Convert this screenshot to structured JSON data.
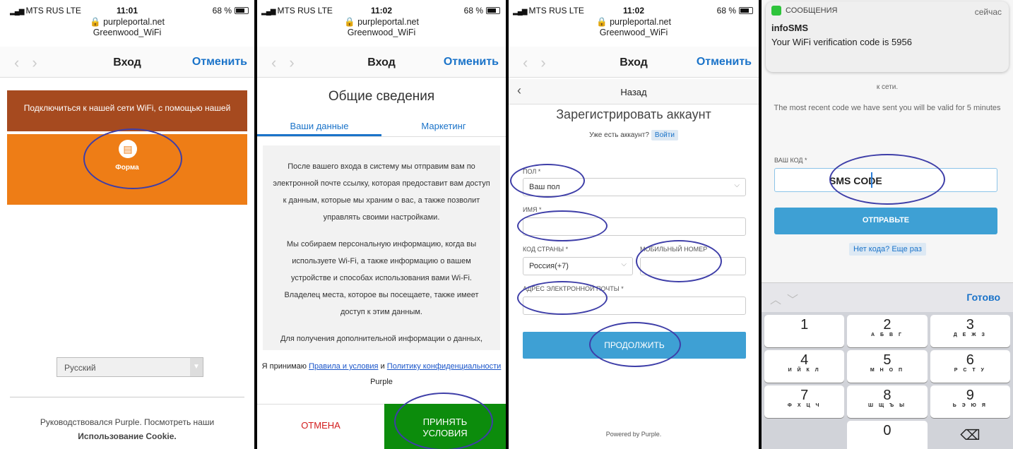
{
  "status": [
    {
      "carrier": "MTS RUS  LTE",
      "time": "11:01",
      "battery": "68 %"
    },
    {
      "carrier": "MTS RUS  LTE",
      "time": "11:02",
      "battery": "68 %"
    },
    {
      "carrier": "MTS RUS  LTE",
      "time": "11:02",
      "battery": "68 %"
    }
  ],
  "browser": {
    "url": "purpleportal.net",
    "network": "Greenwood_WiFi",
    "title": "Вход",
    "cancel": "Отменить"
  },
  "screen1": {
    "banner": "Подключиться к нашей сети WiFi, с помощью нашей",
    "form_label": "Форма",
    "language": "Русский",
    "footer_line1": "Руководствовался Purple. Посмотреть наши",
    "footer_line2": "Использование Cookie."
  },
  "screen2": {
    "heading": "Общие сведения",
    "tab_data": "Ваши данные",
    "tab_marketing": "Маркетинг",
    "para1": "После вашего входа в систему мы отправим вам по электронной почте ссылку, которая предоставит вам доступ к данным, которые мы храним о вас, а также позволит управлять своими настройками.",
    "para2": "Мы собираем персональную информацию, когда вы используете Wi-Fi, а также информацию о вашем устройстве и способах использования вами Wi-Fi. Владелец места, которое вы посещаете, также имеет доступ к этим данным.",
    "para3": "Для получения дополнительной информации о данных, которые мы собираем, а также о способах их",
    "terms_prefix": "Я принимаю",
    "terms_link": "Правила и условия",
    "terms_and": "и",
    "privacy_link": "Политику конфиденциальности",
    "terms_suffix": "Purple",
    "cancel": "ОТМЕНА",
    "accept_line1": "ПРИНЯТЬ",
    "accept_line2": "УСЛОВИЯ"
  },
  "screen3": {
    "back": "Назад",
    "title": "Зарегистрировать аккаунт",
    "have_account": "Уже есть аккаунт?",
    "login": "Войти",
    "gender_label": "ПОЛ *",
    "gender_placeholder": "Ваш пол",
    "name_label": "ИМЯ *",
    "country_label": "КОД СТРАНЫ *",
    "country_value": "Россия(+7)",
    "mobile_label": "МОБИЛЬНЫЙ НОМЕР",
    "email_label": "АДРЕС ЭЛЕКТРОННОЙ ПОЧТЫ *",
    "continue": "ПРОДОЛЖИТЬ",
    "powered": "Powered by Purple."
  },
  "screen4": {
    "notif_app": "СООБЩЕНИЯ",
    "notif_time": "сейчас",
    "notif_from": "infoSMS",
    "notif_text": "Your WiFi verification code is 5956",
    "network_text": "к сети.",
    "info": "The most recent code we have sent you will be valid for 5 minutes",
    "code_label": "ВАШ КОД *",
    "code_value": "SMS CODE",
    "send": "ОТПРАВЬТЕ",
    "resend": "Нет кода? Еще раз",
    "done": "Готово",
    "keys": [
      {
        "n": "1",
        "s": ""
      },
      {
        "n": "2",
        "s": "А Б В Г"
      },
      {
        "n": "3",
        "s": "Д Е Ж З"
      },
      {
        "n": "4",
        "s": "И Й К Л"
      },
      {
        "n": "5",
        "s": "М Н О П"
      },
      {
        "n": "6",
        "s": "Р С Т У"
      },
      {
        "n": "7",
        "s": "Ф Х Ц Ч"
      },
      {
        "n": "8",
        "s": "Ш Щ Ъ Ы"
      },
      {
        "n": "9",
        "s": "Ь Э Ю Я"
      },
      {
        "n": "",
        "s": ""
      },
      {
        "n": "0",
        "s": ""
      },
      {
        "n": "⌫",
        "s": ""
      }
    ]
  }
}
